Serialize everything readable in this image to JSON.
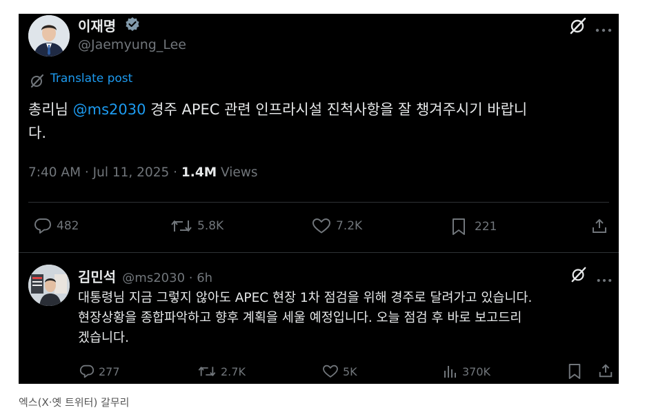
{
  "post": {
    "author_name": "이재명",
    "author_handle": "@Jaemyung_Lee",
    "translate_label": "Translate post",
    "text_before": "총리님 ",
    "mention": "@ms2030",
    "text_line1_after": " 경주 APEC 관련 인프라시설 진척사항을 잘 챙겨주시기 바랍니",
    "text_line2": "다.",
    "time_date": "7:40 AM · Jul 11, 2025 · ",
    "views_count": "1.4M",
    "views_label": " Views",
    "replies": "482",
    "reposts": "5.8K",
    "likes": "7.2K",
    "bookmarks": "221"
  },
  "reply": {
    "author_name": "김민석",
    "author_handle": "@ms2030",
    "time": " · 6h",
    "line1": "대통령님 지금 그렇지 않아도 APEC 현장 1차 점검을 위해 경주로 달려가고 있습니다.",
    "line2": "현장상황을 종합파악하고 향후 계획을 세울 예정입니다. 오늘 점검 후 바로 보고드리",
    "line3": "겠습니다.",
    "replies": "277",
    "reposts": "2.7K",
    "likes": "5K",
    "views": "370K"
  },
  "caption": "엑스(X·옛 트위터) 갈무리",
  "colors": {
    "background": "#000000",
    "text": "#e7e9ea",
    "secondary": "#71767b",
    "link": "#1d9bf0",
    "divider": "#2f3336"
  }
}
